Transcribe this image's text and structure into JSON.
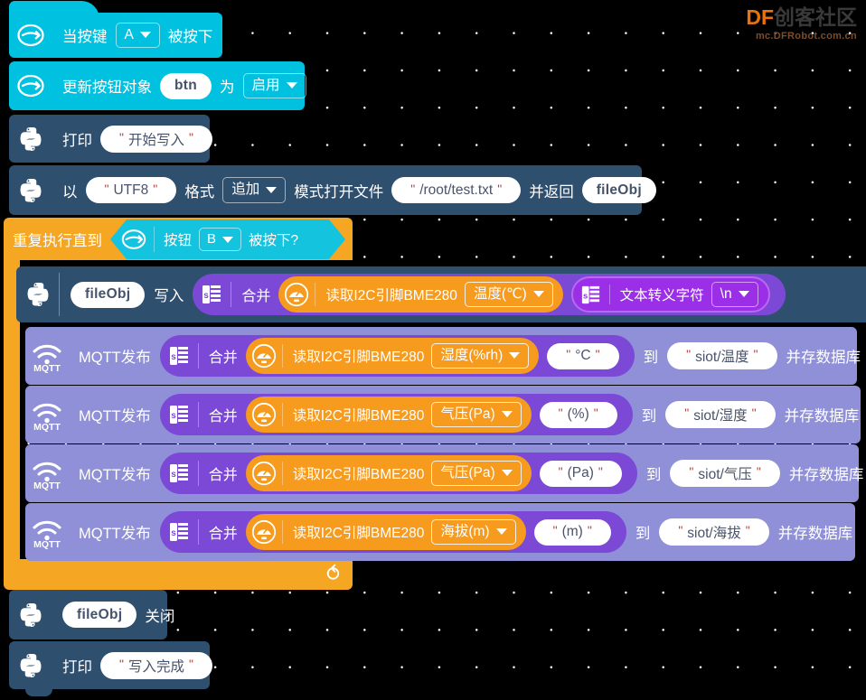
{
  "watermark": {
    "brand_df": "DF",
    "brand_cn": "创客社区",
    "url": "mc.DFRobot.com.cn"
  },
  "blocks": {
    "hat_keypress": {
      "icon": "microbit-logo-icon",
      "label_before": "当按键",
      "key": "A",
      "label_after": "被按下"
    },
    "update_button": {
      "icon": "microbit-logo-icon",
      "label_before": "更新按钮对象",
      "object": "btn",
      "label_mid": "为",
      "state": "启用"
    },
    "print_start": {
      "icon": "python-icon",
      "label": "打印",
      "text": "开始写入"
    },
    "open_file": {
      "icon": "python-icon",
      "label_yi": "以",
      "encoding": "UTF8",
      "label_format": "格式",
      "mode": "追加",
      "label_mode_open": "模式打开文件",
      "path": "/root/test.txt",
      "label_return": "并返回",
      "result_var": "fileObj"
    },
    "repeat_until": {
      "label": "重复执行直到",
      "icon": "microbit-logo-icon",
      "label_button": "按钮",
      "key": "B",
      "label_pressed": "被按下?"
    },
    "file_write": {
      "icon": "python-icon",
      "var": "fileObj",
      "label_write": "写入",
      "join_icon": "text-join-icon",
      "join_label": "合并",
      "sensor_icon": "gauge-icon",
      "sensor_label": "读取I2C引脚BME280",
      "sensor_value": "温度(℃)",
      "escape_icon": "text-join-icon",
      "escape_label": "文本转义字符",
      "escape_value": "\\n"
    },
    "file_close": {
      "icon": "python-icon",
      "var": "fileObj",
      "label": "关闭"
    },
    "print_done": {
      "icon": "python-icon",
      "label": "打印",
      "text": "写入完成"
    }
  },
  "mqtt_rows": [
    {
      "icon": "mqtt-wifi-icon",
      "label": "MQTT发布",
      "join_icon": "text-join-icon",
      "join_label": "合并",
      "sensor_icon": "gauge-icon",
      "sensor_label": "读取I2C引脚BME280",
      "sensor_value": "湿度(%rh)",
      "unit": "°C",
      "label_to": "到",
      "topic": "siot/温度",
      "label_store": "并存数据库"
    },
    {
      "icon": "mqtt-wifi-icon",
      "label": "MQTT发布",
      "join_icon": "text-join-icon",
      "join_label": "合并",
      "sensor_icon": "gauge-icon",
      "sensor_label": "读取I2C引脚BME280",
      "sensor_value": "气压(Pa)",
      "unit": "(%)",
      "label_to": "到",
      "topic": "siot/湿度",
      "label_store": "并存数据库"
    },
    {
      "icon": "mqtt-wifi-icon",
      "label": "MQTT发布",
      "join_icon": "text-join-icon",
      "join_label": "合并",
      "sensor_icon": "gauge-icon",
      "sensor_label": "读取I2C引脚BME280",
      "sensor_value": "气压(Pa)",
      "unit": "(Pa)",
      "label_to": "到",
      "topic": "siot/气压",
      "label_store": "并存数据库"
    },
    {
      "icon": "mqtt-wifi-icon",
      "label": "MQTT发布",
      "join_icon": "text-join-icon",
      "join_label": "合并",
      "sensor_icon": "gauge-icon",
      "sensor_label": "读取I2C引脚BME280",
      "sensor_value": "海拔(m)",
      "unit": "(m)",
      "label_to": "到",
      "topic": "siot/海拔",
      "label_store": "并存数据库"
    }
  ],
  "colors": {
    "event_cyan": "#00C2E0",
    "python_dark": "#2F4F6F",
    "loop_orange": "#F5A623",
    "text_purple": "#7C49D6",
    "mqtt_lavender": "#9090D8",
    "join_magenta": "#9B2FE8",
    "sensor_orange": "#F79B1E"
  }
}
